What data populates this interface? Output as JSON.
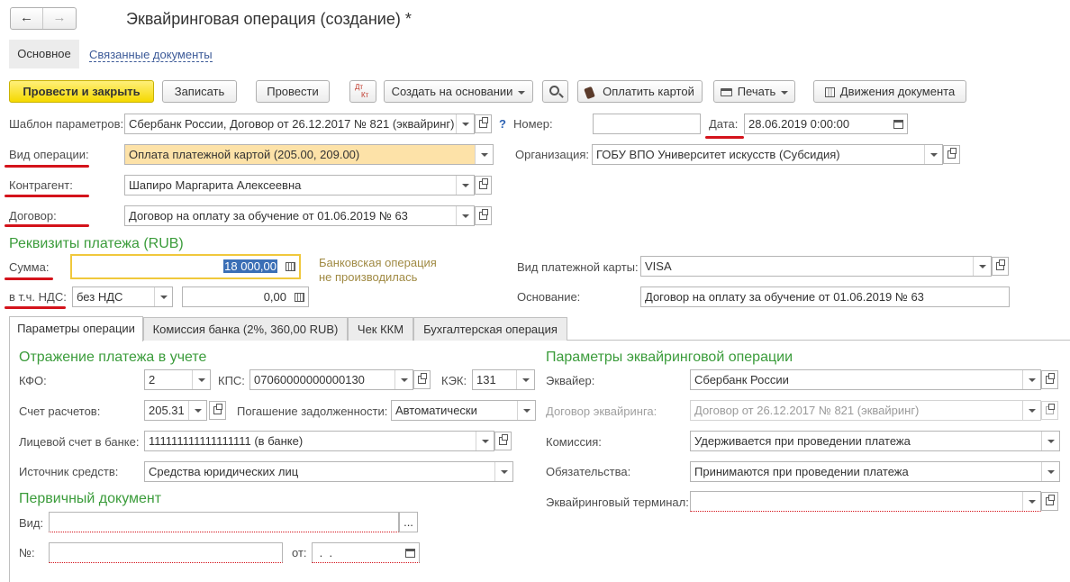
{
  "window": {
    "title": "Эквайринговая операция (создание) *"
  },
  "nav_tabs": {
    "main": "Основное",
    "related": "Связанные документы"
  },
  "toolbar": {
    "post_close": "Провести и закрыть",
    "save": "Записать",
    "post": "Провести",
    "dtkt_top": "Дт",
    "dtkt_bottom": "Кт",
    "create_based": "Создать на основании",
    "pay_card": "Оплатить картой",
    "print": "Печать",
    "movements": "Движения документа"
  },
  "header": {
    "template_label": "Шаблон параметров:",
    "template_value": "Сбербанк России, Договор от 26.12.2017 № 821 (эквайринг)",
    "help": "?",
    "number_label": "Номер:",
    "number_value": "",
    "date_label": "Дата:",
    "date_value": "28.06.2019  0:00:00",
    "op_type_label": "Вид операции:",
    "op_type_value": "Оплата платежной картой (205.00, 209.00)",
    "org_label": "Организация:",
    "org_value": "ГОБУ ВПО Университет искусств (Субсидия)",
    "counterparty_label": "Контрагент:",
    "counterparty_value": "Шапиро Маргарита Алексеевна",
    "contract_label": "Договор:",
    "contract_value": "Договор на оплату за обучение от 01.06.2019 № 63"
  },
  "payment": {
    "section_title": "Реквизиты платежа (RUB)",
    "sum_label": "Сумма:",
    "sum_value": "18 000,00",
    "bank_note_line1": "Банковская операция",
    "bank_note_line2": "не производилась",
    "card_type_label": "Вид платежной карты:",
    "card_type_value": "VISA",
    "vat_label": "в т.ч. НДС:",
    "vat_rate": "без НДС",
    "vat_amount": "0,00",
    "basis_label": "Основание:",
    "basis_value": "Договор на оплату за обучение от 01.06.2019 № 63"
  },
  "tabs": [
    "Параметры операции",
    "Комиссия банка (2%, 360,00 RUB)",
    "Чек ККМ",
    "Бухгалтерская операция"
  ],
  "reflection": {
    "title": "Отражение платежа в учете",
    "kfo_label": "КФО:",
    "kfo_value": "2",
    "kps_label": "КПС:",
    "kps_value": "07060000000000130",
    "kek_label": "КЭК:",
    "kek_value": "131",
    "account_label": "Счет расчетов:",
    "account_value": "205.31",
    "debt_label": "Погашение задолженности:",
    "debt_value": "Автоматически",
    "bank_account_label": "Лицевой счет в банке:",
    "bank_account_value": "111111111111111111 (в банке)",
    "source_label": "Источник средств:",
    "source_value": "Средства юридических лиц"
  },
  "primary_doc": {
    "title": "Первичный документ",
    "kind_label": "Вид:",
    "kind_value": "",
    "kind_btn": "...",
    "num_label": "№:",
    "num_value": "",
    "from_label": "от:",
    "from_value": " .  ."
  },
  "acquiring": {
    "title": "Параметры эквайринговой операции",
    "acquirer_label": "Эквайер:",
    "acquirer_value": "Сбербанк России",
    "contract_label": "Договор эквайринга:",
    "contract_value": "Договор от 26.12.2017 № 821 (эквайринг)",
    "commission_label": "Комиссия:",
    "commission_value": "Удерживается при проведении платежа",
    "obligations_label": "Обязательства:",
    "obligations_value": "Принимаются при проведении платежа",
    "terminal_label": "Эквайринговый терминал:",
    "terminal_value": ""
  }
}
